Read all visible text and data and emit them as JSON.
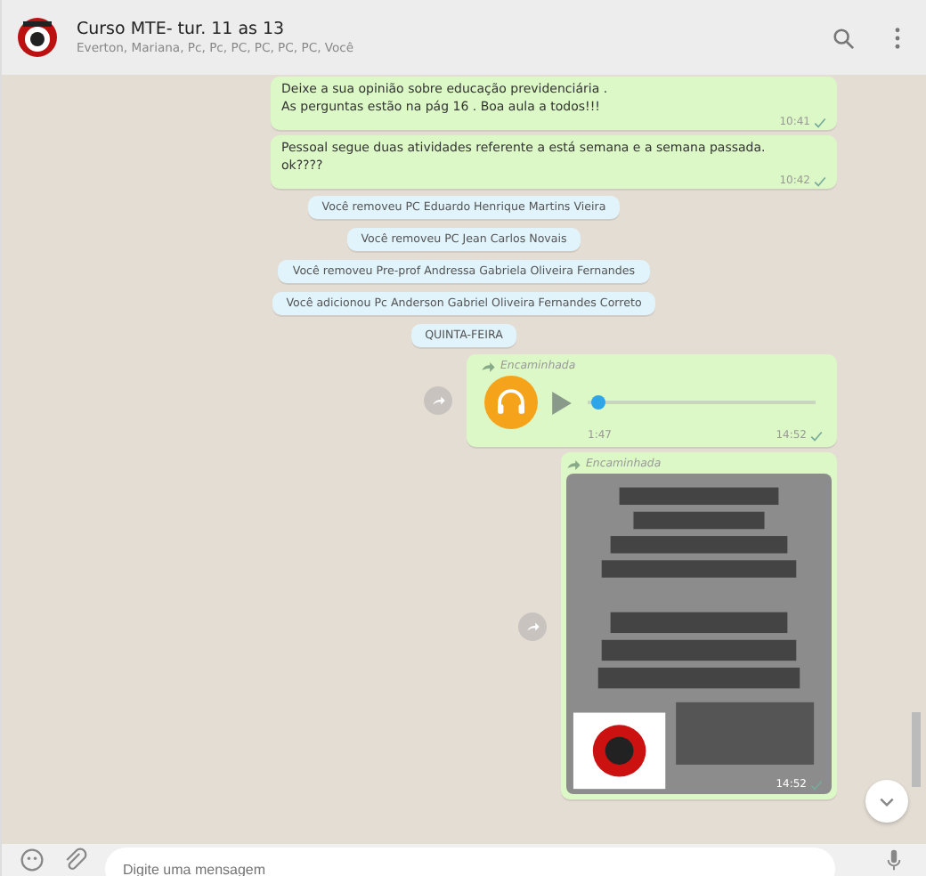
{
  "header": {
    "title": "Curso MTE- tur. 11 as 13",
    "subtitle": "Everton, Mariana, Pc, Pc, PC, PC, PC, PC, Você"
  },
  "messages": [
    {
      "kind": "text",
      "text": "Deixe a sua opinião sobre educação previdenciária .\nAs perguntas estão na pág 16 . Boa aula a todos!!!",
      "time": "10:41"
    },
    {
      "kind": "text",
      "text": "Pessoal segue duas atividades referente a está semana e a semana passada.\nok????",
      "time": "10:42"
    },
    {
      "kind": "system",
      "text": "Você removeu PC Eduardo Henrique Martins Vieira"
    },
    {
      "kind": "system",
      "text": "Você removeu PC Jean Carlos Novais"
    },
    {
      "kind": "system",
      "text": "Você removeu Pre-prof Andressa Gabriela Oliveira Fernandes"
    },
    {
      "kind": "system",
      "text": "Você adicionou Pc Anderson Gabriel Oliveira Fernandes Correto"
    },
    {
      "kind": "system",
      "text": "QUINTA-FEIRA"
    },
    {
      "kind": "audio",
      "forwarded": "Encaminhada",
      "duration": "1:47",
      "time": "14:52",
      "level": 0.02
    },
    {
      "forwarded": "Encaminhada",
      "time": "14:52"
    }
  ],
  "composer": {
    "placeholder": "Digite uma mensagem"
  }
}
